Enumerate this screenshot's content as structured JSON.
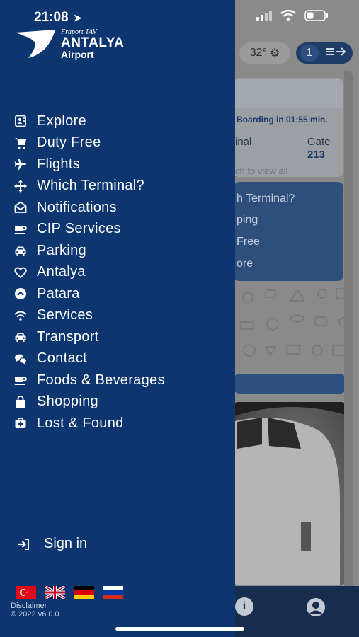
{
  "status_bar": {
    "time": "21:08"
  },
  "drawer": {
    "logo": {
      "small": "Fraport TAV",
      "brand": "ANTALYA",
      "sub": "Airport"
    },
    "menu": [
      {
        "label": "Explore",
        "icon": "contact-card-icon"
      },
      {
        "label": "Duty Free",
        "icon": "cart-icon"
      },
      {
        "label": "Flights",
        "icon": "plane-icon"
      },
      {
        "label": "Which Terminal?",
        "icon": "move-arrows-icon"
      },
      {
        "label": "Notifications",
        "icon": "envelope-open-icon"
      },
      {
        "label": "CIP Services",
        "icon": "coffee-cup-icon"
      },
      {
        "label": "Parking",
        "icon": "car-icon"
      },
      {
        "label": "Antalya",
        "icon": "heart-icon"
      },
      {
        "label": "Patara",
        "icon": "chevron-circle-up-icon"
      },
      {
        "label": "Services",
        "icon": "wifi-icon"
      },
      {
        "label": "Transport",
        "icon": "car-icon"
      },
      {
        "label": "Contact",
        "icon": "chat-bubbles-icon"
      },
      {
        "label": "Foods & Beverages",
        "icon": "coffee-cup-icon"
      },
      {
        "label": "Shopping",
        "icon": "shopping-bag-icon"
      },
      {
        "label": "Lost & Found",
        "icon": "first-aid-box-icon"
      }
    ],
    "sign_in": "Sign in",
    "flags": [
      "turkish-flag",
      "uk-flag",
      "german-flag",
      "russian-flag"
    ],
    "disclaimer": "Disclaimer",
    "version": "© 2022 v6.0.0"
  },
  "background": {
    "temperature": "32°",
    "flight_count": "1",
    "boarding": "Boarding in 01:55 min.",
    "terminal_label": "inal",
    "gate_label": "Gate",
    "gate_value": "213",
    "touch_hint": "ch to view all",
    "blue_card_lines": [
      "h Terminal?",
      "ping",
      "Free",
      "ore"
    ]
  },
  "colors": {
    "drawer": "#0d3570",
    "accent_dark": "#162d4e"
  }
}
